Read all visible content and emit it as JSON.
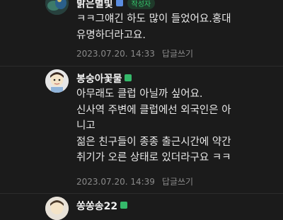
{
  "comments": [
    {
      "nickname": "밝은별빛",
      "badge": "작성자",
      "grade_color": "#5b8de0",
      "lines": [
        "ㅋㅋ그얘긴 하도 많이 들었어요.홍대",
        "유명하더라고요."
      ],
      "timestamp": "2023.07.20. 14:33",
      "reply_label": "답글쓰기"
    },
    {
      "nickname": "봉숭아꽃물",
      "grade_color": "#35b86a",
      "lines": [
        "아무래도 클럽 아닐까 싶어요.",
        "신사역 주변에 클럽에선 외국인은 아",
        "니고",
        "젊은 친구들이 종종 출근시간에 약간",
        "취기가 오른 상태로 있더라구요 ㅋㅋ"
      ],
      "timestamp": "2023.07.20. 14:39",
      "reply_label": "답글쓰기"
    },
    {
      "nickname": "쏭쏭송22",
      "grade_color": "#35b86a"
    }
  ],
  "avatar_icons": [
    "avatar-peacock-icon",
    "avatar-cartoon-icon",
    "avatar-cartoon-icon"
  ]
}
